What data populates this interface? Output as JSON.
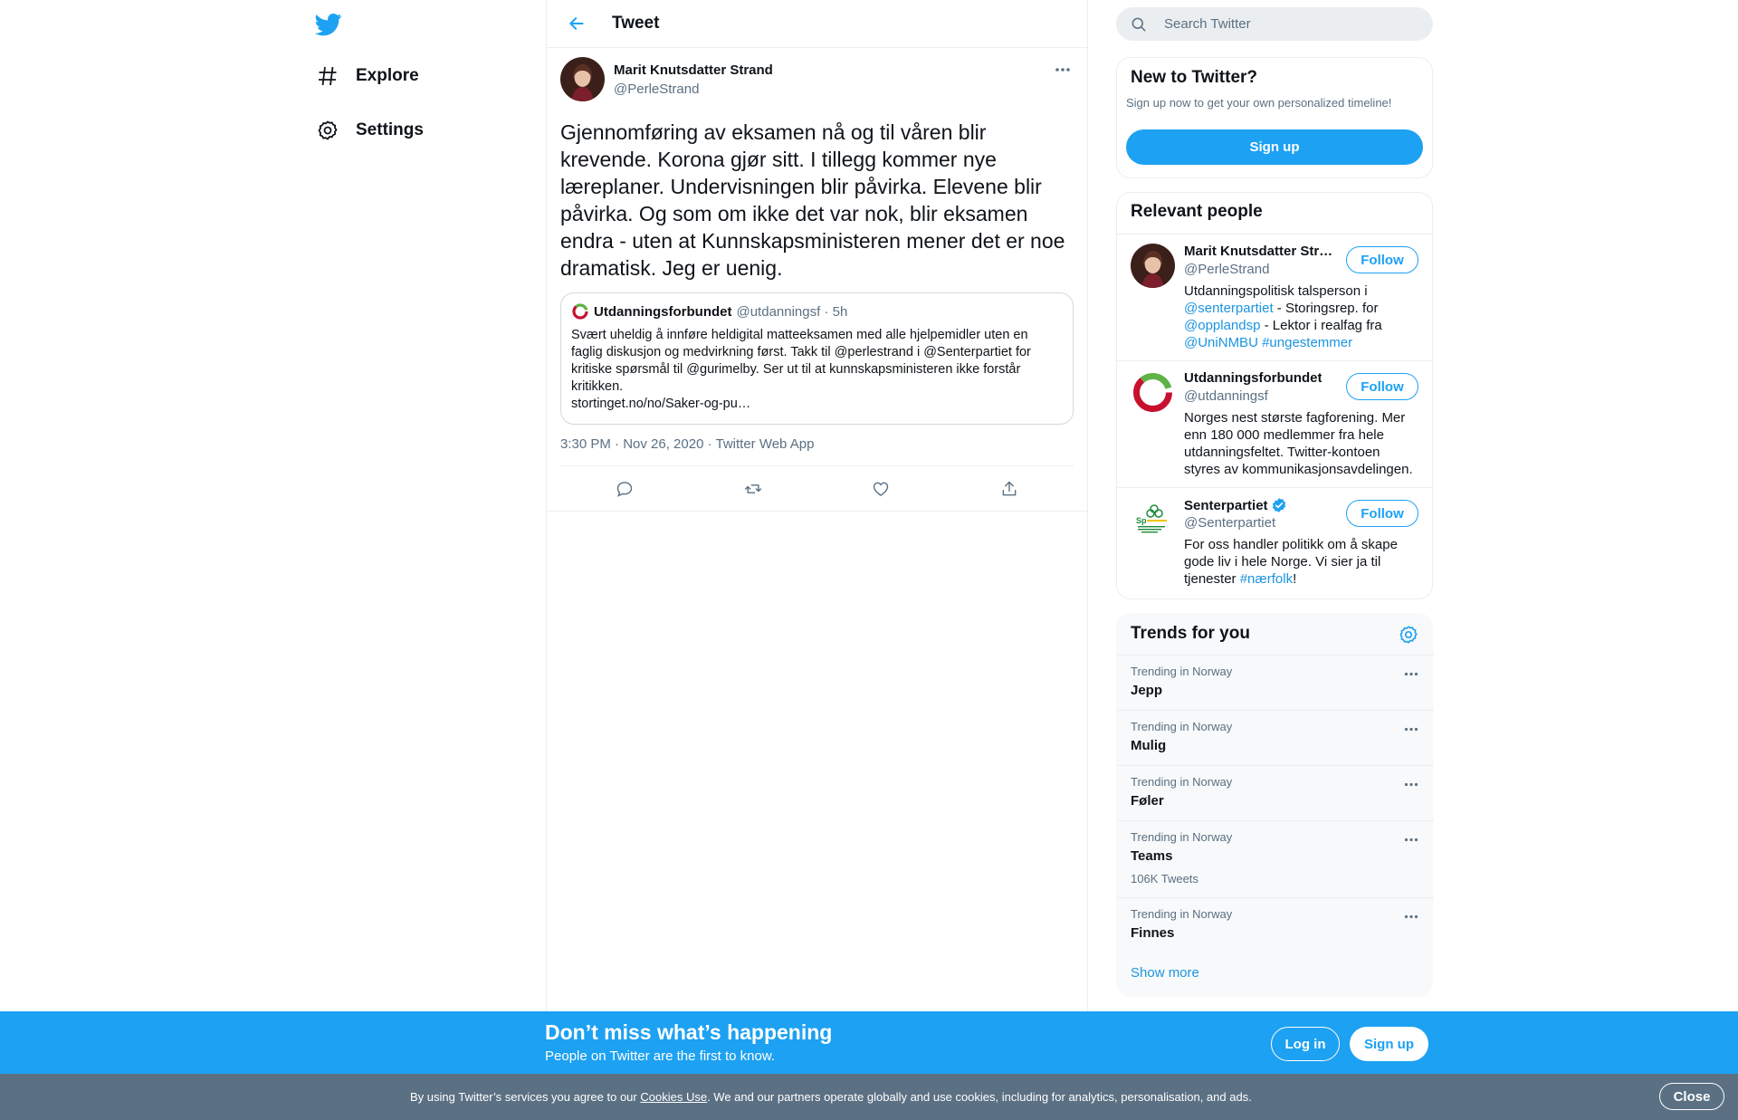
{
  "colors": {
    "accent": "#1da1f2",
    "link": "#1b95e0",
    "muted": "#5b7083",
    "cookie_bg": "#5b7083"
  },
  "nav": {
    "logo_icon": "twitter-bird-icon",
    "items": [
      {
        "label": "Explore",
        "icon": "hashtag-icon"
      },
      {
        "label": "Settings",
        "icon": "gear-icon"
      }
    ]
  },
  "header": {
    "title": "Tweet",
    "back_icon": "arrow-left-icon"
  },
  "tweet": {
    "author_name": "Marit Knutsdatter Strand",
    "author_handle": "@PerleStrand",
    "text": "Gjennomføring av eksamen nå og til våren blir krevende. Korona gjør sitt. I tillegg kommer nye læreplaner. Undervisningen blir påvirka. Elevene blir påvirka. Og som om ikke det var nok, blir eksamen endra - uten at Kunnskapsministeren mener det er noe dramatisk. Jeg er uenig.",
    "quote": {
      "name": "Utdanningsforbundet",
      "meta": "@utdanningsf · 5h",
      "text": "Svært uheldig å innføre heldigital matteeksamen med alle hjelpemidler uten en faglig diskusjon og medvirkning først. Takk til @perlestrand i @Senterpartiet for kritiske spørsmål til @gurimelby. Ser ut til at kunnskapsministeren ikke forstår kritikken.",
      "link": "stortinget.no/no/Saker-og-pu…"
    },
    "meta": "3:30 PM · Nov 26, 2020 · Twitter Web App"
  },
  "search": {
    "placeholder": "Search Twitter"
  },
  "new_to_twitter": {
    "title": "New to Twitter?",
    "desc": "Sign up now to get your own personalized timeline!",
    "button": "Sign up"
  },
  "relevant": {
    "title": "Relevant people",
    "people": [
      {
        "name": "Marit Knutsdatter Str…",
        "handle": "@PerleStrand",
        "follow": "Follow",
        "bio_parts": [
          "Utdanningspolitisk talsperson i ",
          "@senterpartiet",
          " - Storingsrep. for ",
          "@opplandsp",
          " - Lektor i realfag fra ",
          "@UniNMBU",
          " ",
          "#ungestemmer"
        ]
      },
      {
        "name": "Utdanningsforbundet",
        "handle": "@utdanningsf",
        "follow": "Follow",
        "bio": "Norges nest største fagforening. Mer enn 180 000 medlemmer fra hele utdanningsfeltet. Twitter-kontoen styres av kommunikasjonsavdelingen."
      },
      {
        "name": "Senterpartiet",
        "handle": "@Senterpartiet",
        "follow": "Follow",
        "bio_parts": [
          "For oss handler politikk om å skape gode liv i hele Norge. Vi sier ja til tjenester ",
          "#nærfolk",
          "!"
        ]
      }
    ]
  },
  "trends": {
    "title": "Trends for you",
    "items": [
      {
        "context": "Trending in Norway",
        "name": "Jepp"
      },
      {
        "context": "Trending in Norway",
        "name": "Mulig"
      },
      {
        "context": "Trending in Norway",
        "name": "Føler"
      },
      {
        "context": "Trending in Norway",
        "name": "Teams",
        "count": "106K Tweets"
      },
      {
        "context": "Trending in Norway",
        "name": "Finnes"
      }
    ],
    "show_more": "Show more"
  },
  "banner": {
    "title": "Don’t miss what’s happening",
    "subtitle": "People on Twitter are the first to know.",
    "login": "Log in",
    "signup": "Sign up"
  },
  "cookie": {
    "before": "By using Twitter’s services you agree to our ",
    "link": "Cookies Use",
    "after": ". We and our partners operate globally and use cookies, including for analytics, personalisation, and ads.",
    "close": "Close"
  }
}
